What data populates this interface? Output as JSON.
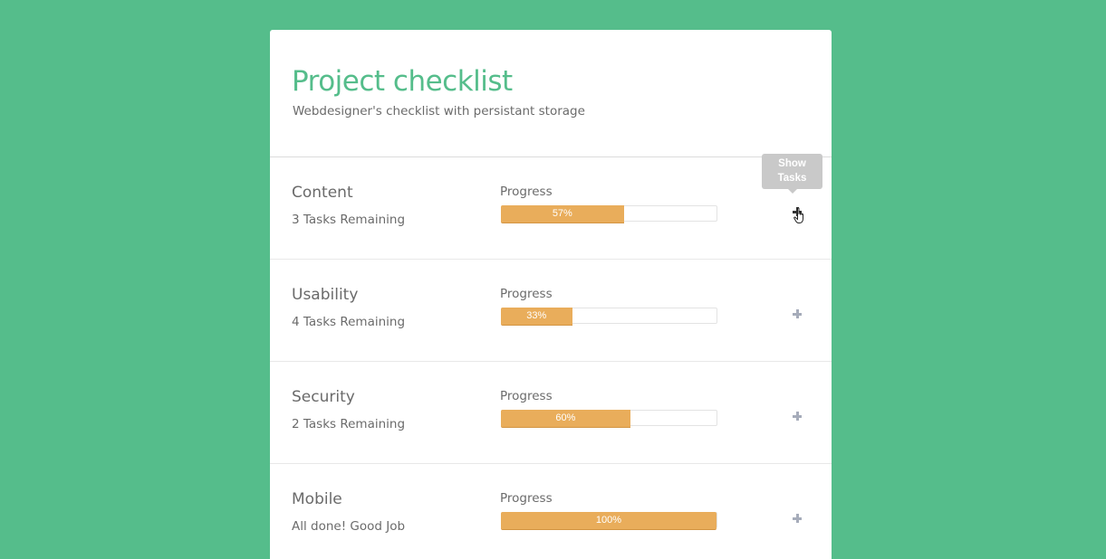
{
  "header": {
    "title": "Project checklist",
    "subtitle": "Webdesigner's checklist with persistant storage"
  },
  "progress_label": "Progress",
  "tooltip": {
    "line1": "Show",
    "line2": "Tasks"
  },
  "colors": {
    "background": "#55bd8b",
    "accent": "#55bd8b",
    "progress_fill": "#e9ad5b",
    "plus_icon": "#a6acba"
  },
  "sections": [
    {
      "name": "Content",
      "remaining": "3 Tasks Remaining",
      "progress": 57,
      "progress_text": "57%",
      "icon": "plus-icon",
      "hovered": true
    },
    {
      "name": "Usability",
      "remaining": "4 Tasks Remaining",
      "progress": 33,
      "progress_text": "33%",
      "icon": "plus-icon",
      "hovered": false
    },
    {
      "name": "Security",
      "remaining": "2 Tasks Remaining",
      "progress": 60,
      "progress_text": "60%",
      "icon": "plus-icon",
      "hovered": false
    },
    {
      "name": "Mobile",
      "remaining": "All done! Good Job",
      "progress": 100,
      "progress_text": "100%",
      "icon": "plus-icon",
      "hovered": false
    }
  ]
}
